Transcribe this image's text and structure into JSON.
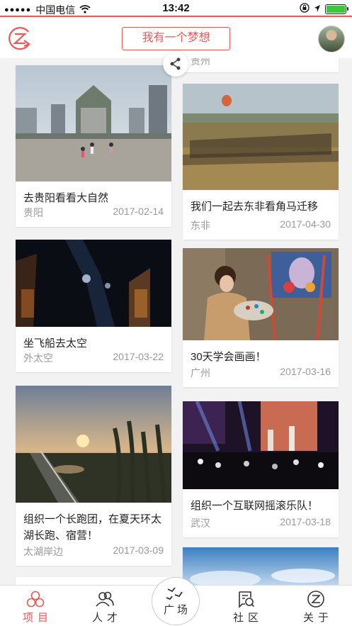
{
  "status": {
    "carrier": "中国电信",
    "time": "13:42"
  },
  "header": {
    "dream_button": "我有一个梦想"
  },
  "feed": {
    "partial_top_location": "贵州",
    "cards": [
      {
        "title": "去贵阳看看大自然",
        "location": "贵阳",
        "date": "2017-02-14"
      },
      {
        "title": "我们一起去东非看角马迁移",
        "location": "东非",
        "date": "2017-04-30"
      },
      {
        "title": "坐飞船去太空",
        "location": "外太空",
        "date": "2017-03-22"
      },
      {
        "title": "30天学会画画！",
        "location": "广州",
        "date": "2017-03-16"
      },
      {
        "title": "组织一个长跑团，在夏天环太湖长跑、宿营！",
        "location": "太湖岸边",
        "date": "2017-03-09"
      },
      {
        "title": "组织一个互联网摇滚乐队！",
        "location": "武汉",
        "date": "2017-03-18"
      }
    ]
  },
  "tabs": {
    "projects": "项目",
    "talent": "人才",
    "plaza": "广场",
    "community": "社区",
    "about": "关于"
  },
  "colors": {
    "accent": "#e85a5a",
    "text": "#222222",
    "meta": "#999999"
  }
}
